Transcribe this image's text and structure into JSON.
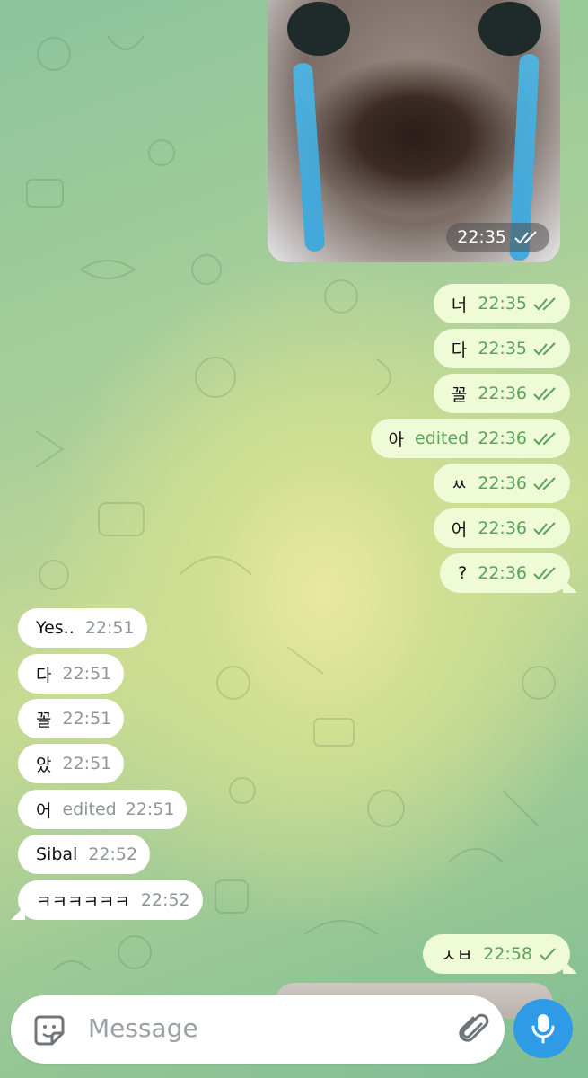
{
  "photo_message": {
    "time": "22:35"
  },
  "outgoing": [
    {
      "text": "너",
      "edited": "",
      "time": "22:35",
      "status": "read"
    },
    {
      "text": "다",
      "edited": "",
      "time": "22:35",
      "status": "read"
    },
    {
      "text": "꼴",
      "edited": "",
      "time": "22:36",
      "status": "read"
    },
    {
      "text": "아",
      "edited": "edited",
      "time": "22:36",
      "status": "read"
    },
    {
      "text": "ㅆ",
      "edited": "",
      "time": "22:36",
      "status": "read"
    },
    {
      "text": "어",
      "edited": "",
      "time": "22:36",
      "status": "read"
    },
    {
      "text": "?",
      "edited": "",
      "time": "22:36",
      "status": "read"
    }
  ],
  "incoming": [
    {
      "text": "Yes..",
      "edited": "",
      "time": "22:51"
    },
    {
      "text": "다",
      "edited": "",
      "time": "22:51"
    },
    {
      "text": "꼴",
      "edited": "",
      "time": "22:51"
    },
    {
      "text": "았",
      "edited": "",
      "time": "22:51"
    },
    {
      "text": "어",
      "edited": "edited",
      "time": "22:51"
    },
    {
      "text": "Sibal",
      "edited": "",
      "time": "22:52"
    },
    {
      "text": "ㅋㅋㅋㅋㅋㅋ",
      "edited": "",
      "time": "22:52"
    }
  ],
  "last_outgoing": {
    "text": "ㅅㅂ",
    "time": "22:58",
    "status": "sent"
  },
  "composer": {
    "placeholder": "Message"
  },
  "icons": {
    "sticker": "sticker-icon",
    "attach": "paperclip-icon",
    "mic": "microphone-icon",
    "read": "double-check-icon",
    "sent": "single-check-icon"
  },
  "colors": {
    "outgoing_bubble": "#eefbd6",
    "incoming_bubble": "#ffffff",
    "check_green": "#5aa35a",
    "mic_blue": "#2f9ae6"
  }
}
